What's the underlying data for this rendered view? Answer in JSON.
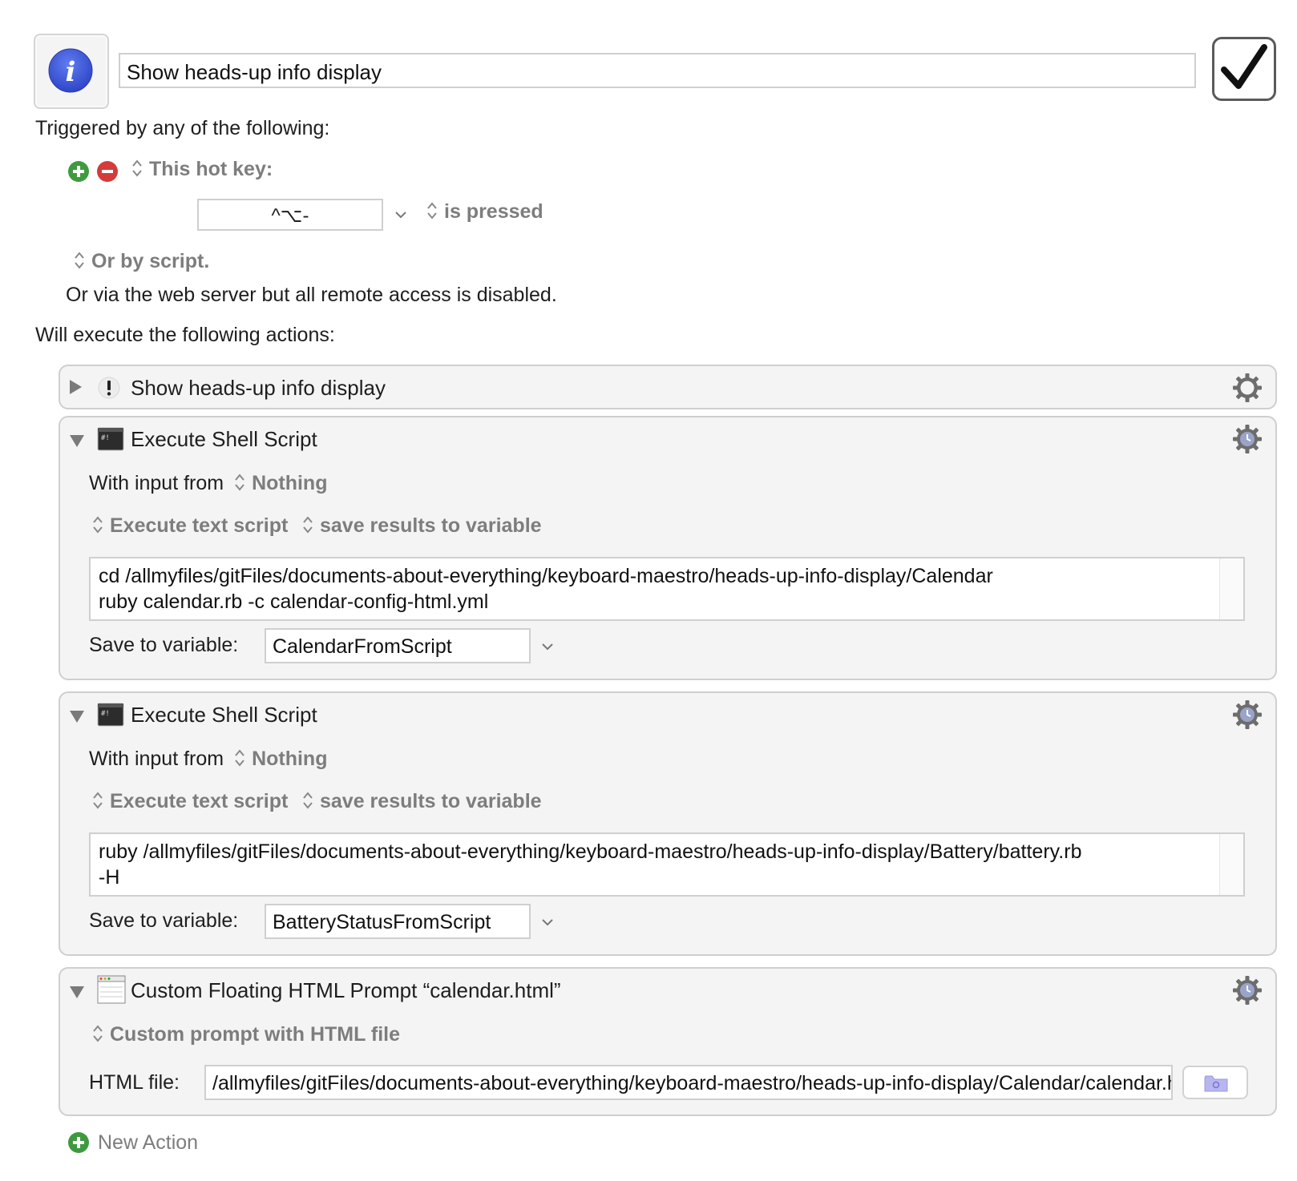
{
  "macro": {
    "name": "Show heads-up info display",
    "enabled": true
  },
  "triggers": {
    "heading": "Triggered by any of the following:",
    "hotkey_label": "This hot key:",
    "hotkey_value": "^⌥-",
    "hotkey_condition": "is pressed",
    "or_by_script": "Or by script.",
    "web_server_note": "Or via the web server but all remote access is disabled."
  },
  "actions_heading": "Will execute the following actions:",
  "actions": [
    {
      "title": "Show heads-up info display",
      "collapsed": true
    },
    {
      "title": "Execute Shell Script",
      "input_label": "With input from",
      "input_value": "Nothing",
      "script_type": "Execute text script",
      "result_type": "save results to variable",
      "script_line1": "cd /allmyfiles/gitFiles/documents-about-everything/keyboard-maestro/heads-up-info-display/Calendar",
      "script_line2": "ruby calendar.rb -c calendar-config-html.yml",
      "save_label": "Save to variable:",
      "variable": "CalendarFromScript"
    },
    {
      "title": "Execute Shell Script",
      "input_label": "With input from",
      "input_value": "Nothing",
      "script_type": "Execute text script",
      "result_type": "save results to variable",
      "script_line1": "ruby /allmyfiles/gitFiles/documents-about-everything/keyboard-maestro/heads-up-info-display/Battery/battery.rb",
      "script_line2": "-H",
      "save_label": "Save to variable:",
      "variable": "BatteryStatusFromScript"
    },
    {
      "title": "Custom Floating HTML Prompt “calendar.html”",
      "prompt_type": "Custom prompt with HTML file",
      "file_label": "HTML file:",
      "file_value": "/allmyfiles/gitFiles/documents-about-everything/keyboard-maestro/heads-up-info-display/Calendar/calendar.html"
    }
  ],
  "new_action_label": "New Action",
  "colors": {
    "panel_bg": "#f4f4f4",
    "border": "#cfcfcf",
    "add_green": "#3f9a3f",
    "remove_red": "#d43b3b",
    "info_blue": "#3b55d9",
    "label_gray": "#7d7d7d"
  }
}
